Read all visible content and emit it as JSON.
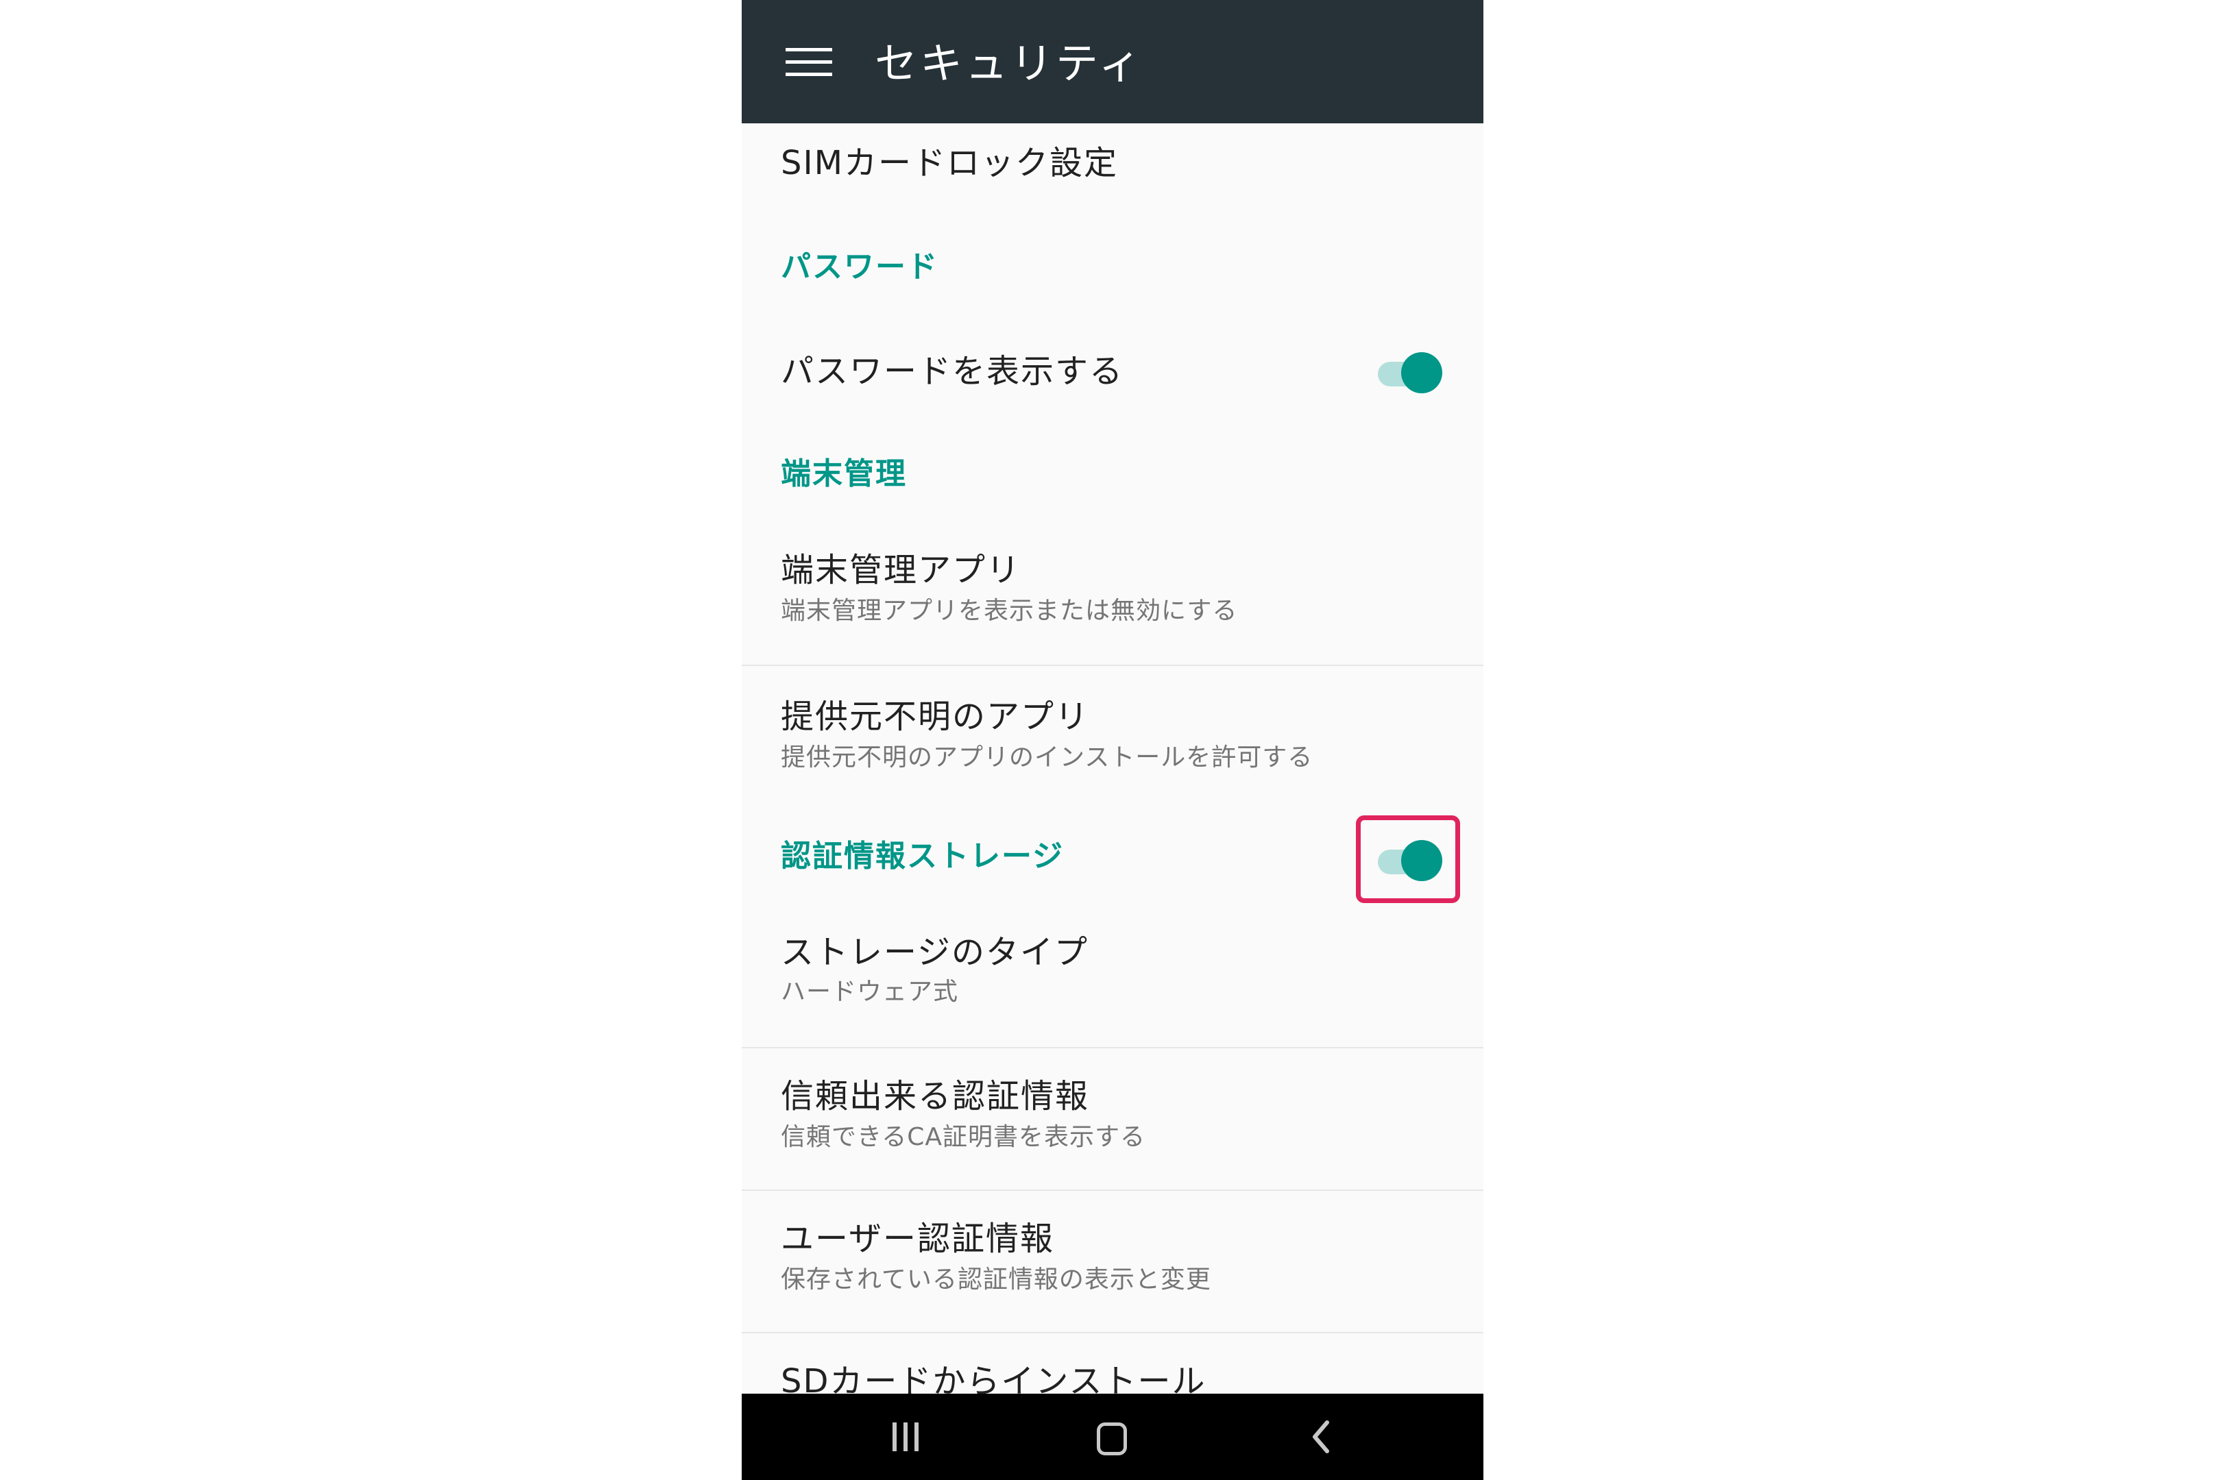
{
  "appbar": {
    "title": "セキュリティ",
    "menu_icon": "hamburger-menu-icon",
    "background": "#263238"
  },
  "accent_color": "#009688",
  "highlight_color": "#e0245e",
  "settings": {
    "sim_lock": {
      "title": "SIMカードロック設定"
    },
    "password_category": "パスワード",
    "show_password": {
      "title": "パスワードを表示する",
      "enabled": true
    },
    "device_admin_category": "端末管理",
    "device_admin_apps": {
      "title": "端末管理アプリ",
      "summary": "端末管理アプリを表示または無効にする"
    },
    "unknown_sources": {
      "title": "提供元不明のアプリ",
      "summary": "提供元不明のアプリのインストールを許可する",
      "enabled": true,
      "highlighted": true
    },
    "credential_storage_category": "認証情報ストレージ",
    "storage_type": {
      "title": "ストレージのタイプ",
      "summary": "ハードウェア式"
    },
    "trusted_credentials": {
      "title": "信頼出来る認証情報",
      "summary": "信頼できるCA証明書を表示する"
    },
    "user_credentials": {
      "title": "ユーザー認証情報",
      "summary": "保存されている認証情報の表示と変更"
    },
    "install_from_sd": {
      "title": "SDカードからインストール"
    }
  },
  "navbar": {
    "recents_icon": "recents-icon",
    "home_icon": "home-icon",
    "back_icon": "back-icon"
  }
}
